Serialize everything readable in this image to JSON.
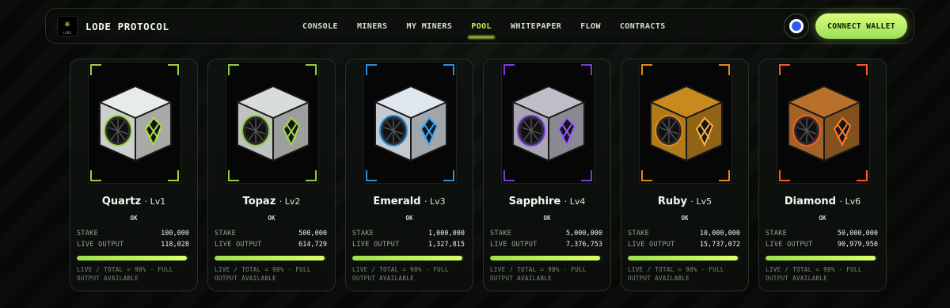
{
  "brand": {
    "name": "LODE PROTOCOL",
    "logo_text": "LODE",
    "logo_icon": "star-icon",
    "accent": "#c8f04a"
  },
  "nav": {
    "links": [
      {
        "label": "CONSOLE",
        "active": false
      },
      {
        "label": "MINERS",
        "active": false
      },
      {
        "label": "MY MINERS",
        "active": false
      },
      {
        "label": "POOL",
        "active": true
      },
      {
        "label": "WHITEPAPER",
        "active": false
      },
      {
        "label": "FLOW",
        "active": false
      },
      {
        "label": "CONTRACTS",
        "active": false
      }
    ],
    "network_icon": "network-icon",
    "connect_label": "CONNECT WALLET"
  },
  "pool": {
    "cards": [
      {
        "name": "Quartz",
        "level": "· Lv1",
        "status": "OK",
        "stake_label": "STAKE",
        "stake": "100,000",
        "output_label": "LIVE OUTPUT",
        "output": "118,028",
        "progress": 0.98,
        "note": "LIVE / TOTAL = 98% · FULL OUTPUT AVAILABLE",
        "accent": "#9bd13a",
        "shell": "#e8ece8",
        "glow": "#a8e04a"
      },
      {
        "name": "Topaz",
        "level": "· Lv2",
        "status": "OK",
        "stake_label": "STAKE",
        "stake": "500,000",
        "output_label": "LIVE OUTPUT",
        "output": "614,729",
        "progress": 0.98,
        "note": "LIVE / TOTAL = 98% · FULL OUTPUT AVAILABLE",
        "accent": "#8ccf3a",
        "shell": "#d9ddd9",
        "glow": "#9fd84a"
      },
      {
        "name": "Emerald",
        "level": "· Lv3",
        "status": "OK",
        "stake_label": "STAKE",
        "stake": "1,000,000",
        "output_label": "LIVE OUTPUT",
        "output": "1,327,815",
        "progress": 0.98,
        "note": "LIVE / TOTAL = 98% · FULL OUTPUT AVAILABLE",
        "accent": "#2f8fd8",
        "shell": "#dfe6ee",
        "glow": "#3aa8ff"
      },
      {
        "name": "Sapphire",
        "level": "· Lv4",
        "status": "OK",
        "stake_label": "STAKE",
        "stake": "5,000,000",
        "output_label": "LIVE OUTPUT",
        "output": "7,376,753",
        "progress": 0.98,
        "note": "LIVE / TOTAL = 98% · FULL OUTPUT AVAILABLE",
        "accent": "#7a3cd8",
        "shell": "#bfbdc8",
        "glow": "#9a5cff"
      },
      {
        "name": "Ruby",
        "level": "· Lv5",
        "status": "OK",
        "stake_label": "STAKE",
        "stake": "10,000,000",
        "output_label": "LIVE OUTPUT",
        "output": "15,737,072",
        "progress": 0.98,
        "note": "LIVE / TOTAL = 98% · FULL OUTPUT AVAILABLE",
        "accent": "#e08a12",
        "shell": "#c88a1e",
        "glow": "#ffb23a"
      },
      {
        "name": "Diamond",
        "level": "· Lv6",
        "status": "OK",
        "stake_label": "STAKE",
        "stake": "50,000,000",
        "output_label": "LIVE OUTPUT",
        "output": "90,979,950",
        "progress": 0.98,
        "note": "LIVE / TOTAL = 98% · FULL OUTPUT AVAILABLE",
        "accent": "#ff5a1e",
        "shell": "#b8702a",
        "glow": "#ff7a2a"
      }
    ]
  }
}
